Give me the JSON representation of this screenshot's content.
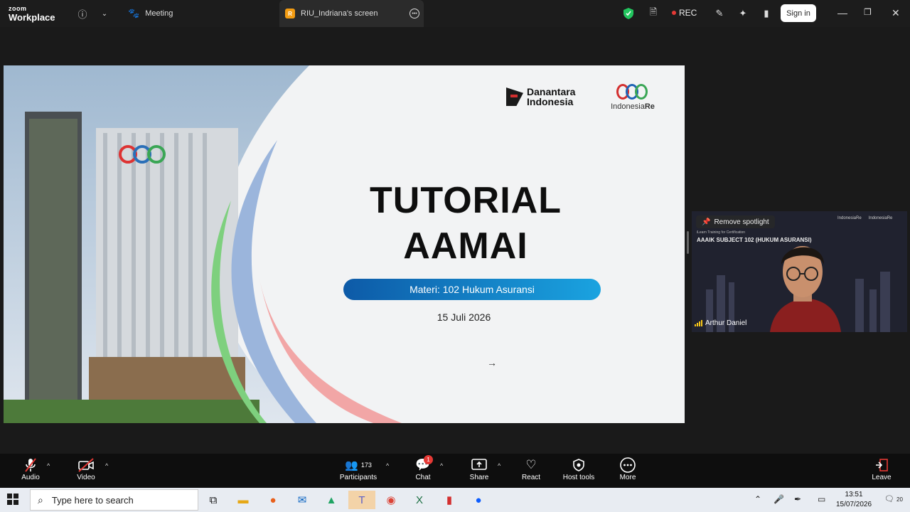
{
  "titlebar": {
    "logo_top": "zoom",
    "logo_bottom": "Workplace",
    "tab_meeting": "Meeting",
    "tab_active": "RIU_Indriana's screen",
    "tab_badge": "R",
    "rec": "REC",
    "signin": "Sign in"
  },
  "slide": {
    "logo1": "Danantara Indonesia",
    "logo2_name": "Indonesia",
    "logo2_suffix": "Re",
    "title_line1": "TUTORIAL",
    "title_line2": "AAMAI",
    "pill": "Materi: 102 Hukum Asuransi",
    "date": "15 Juli 2026"
  },
  "video": {
    "spotlight": "Remove spotlight",
    "sub_small": "iLearn Training for Certification",
    "sub_title": "AAAIK SUBJECT 102 (HUKUM ASURANSI)",
    "logo_a": "IndonesiaRe",
    "logo_b": "IndonesiaRe",
    "name": "Arthur Daniel"
  },
  "toolbar": {
    "audio": "Audio",
    "video": "Video",
    "participants": "Participants",
    "participants_count": "173",
    "chat": "Chat",
    "chat_badge": "1",
    "share": "Share",
    "react": "React",
    "host_tools": "Host tools",
    "more": "More",
    "leave": "Leave"
  },
  "taskbar": {
    "search_placeholder": "Type here to search",
    "time": "13:51",
    "date": "15/07/2026",
    "notif_count": "20"
  },
  "colors": {
    "rec_dot": "#e53935",
    "pill_start": "#0d5aa7",
    "pill_end": "#1aa3e0",
    "shield": "#22c55e"
  }
}
